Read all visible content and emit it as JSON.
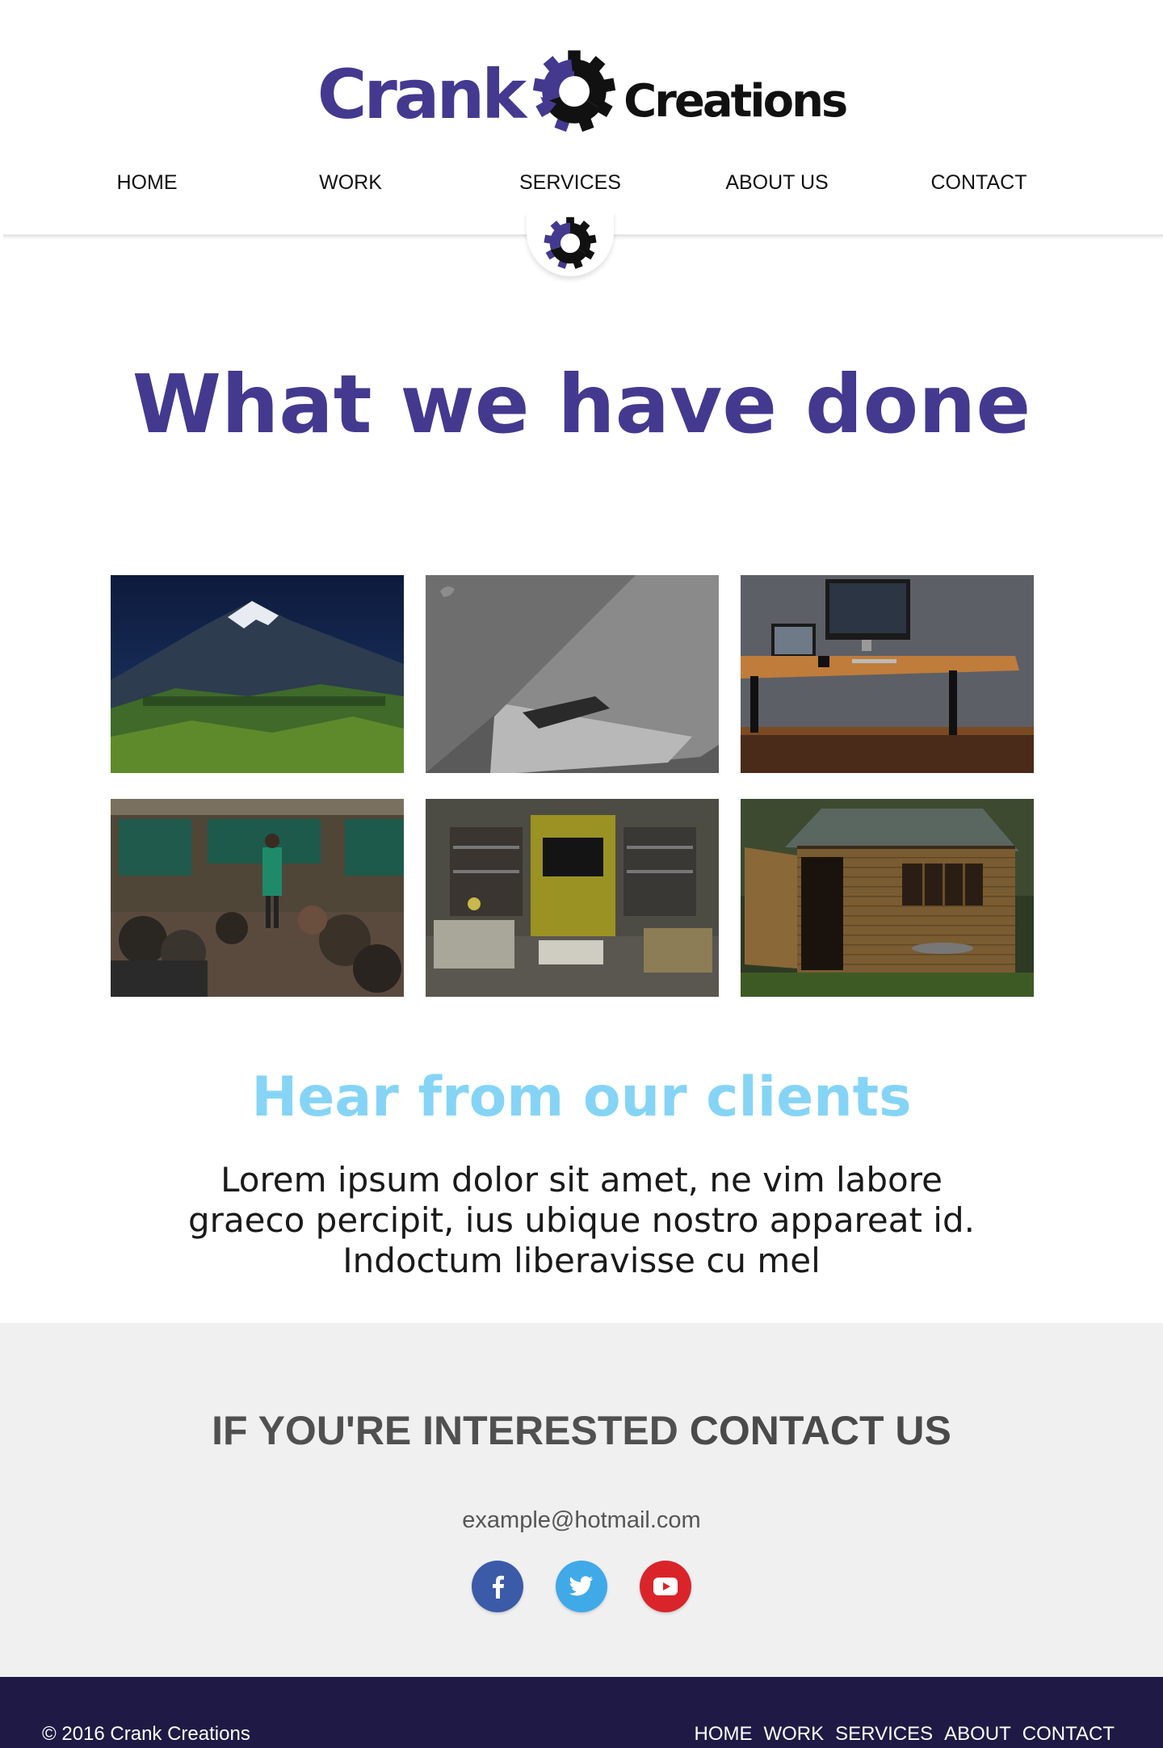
{
  "brand": {
    "name_part1": "Crank",
    "name_part2": "Creations",
    "colors": {
      "primary": "#43398f",
      "accent": "#85d4f6",
      "dark": "#1e1a45"
    }
  },
  "nav": {
    "items": [
      {
        "label": "HOME"
      },
      {
        "label": "WORK"
      },
      {
        "label": "SERVICES"
      },
      {
        "label": "ABOUT US"
      },
      {
        "label": "CONTACT"
      }
    ],
    "badge_icon": "gear-logo-icon"
  },
  "work": {
    "title": "What we have done",
    "images": [
      {
        "icon": "mountain-landscape-image"
      },
      {
        "icon": "laptop-closeup-image"
      },
      {
        "icon": "office-desk-image"
      },
      {
        "icon": "classroom-image"
      },
      {
        "icon": "living-room-image"
      },
      {
        "icon": "garden-shed-image"
      }
    ]
  },
  "clients": {
    "title": "Hear from our clients",
    "text": "Lorem ipsum dolor sit amet, ne vim labore graeco percipit, ius ubique nostro appareat id. Indoctum liberavisse cu mel"
  },
  "contact": {
    "heading_light": "IF YOU'RE INTERESTED",
    "heading_bold": "CONTACT US",
    "email": "example@hotmail.com",
    "socials": [
      {
        "name": "facebook-icon",
        "glyph": "f",
        "color": "#3b5ba8"
      },
      {
        "name": "twitter-icon",
        "glyph": "t",
        "color": "#40a9e8"
      },
      {
        "name": "youtube-icon",
        "glyph": "▶",
        "color": "#d9252a"
      }
    ]
  },
  "footer": {
    "copyright": "© 2016 Crank Creations",
    "links": [
      "HOME",
      "WORK",
      "SERVICES",
      "ABOUT",
      "CONTACT"
    ]
  }
}
